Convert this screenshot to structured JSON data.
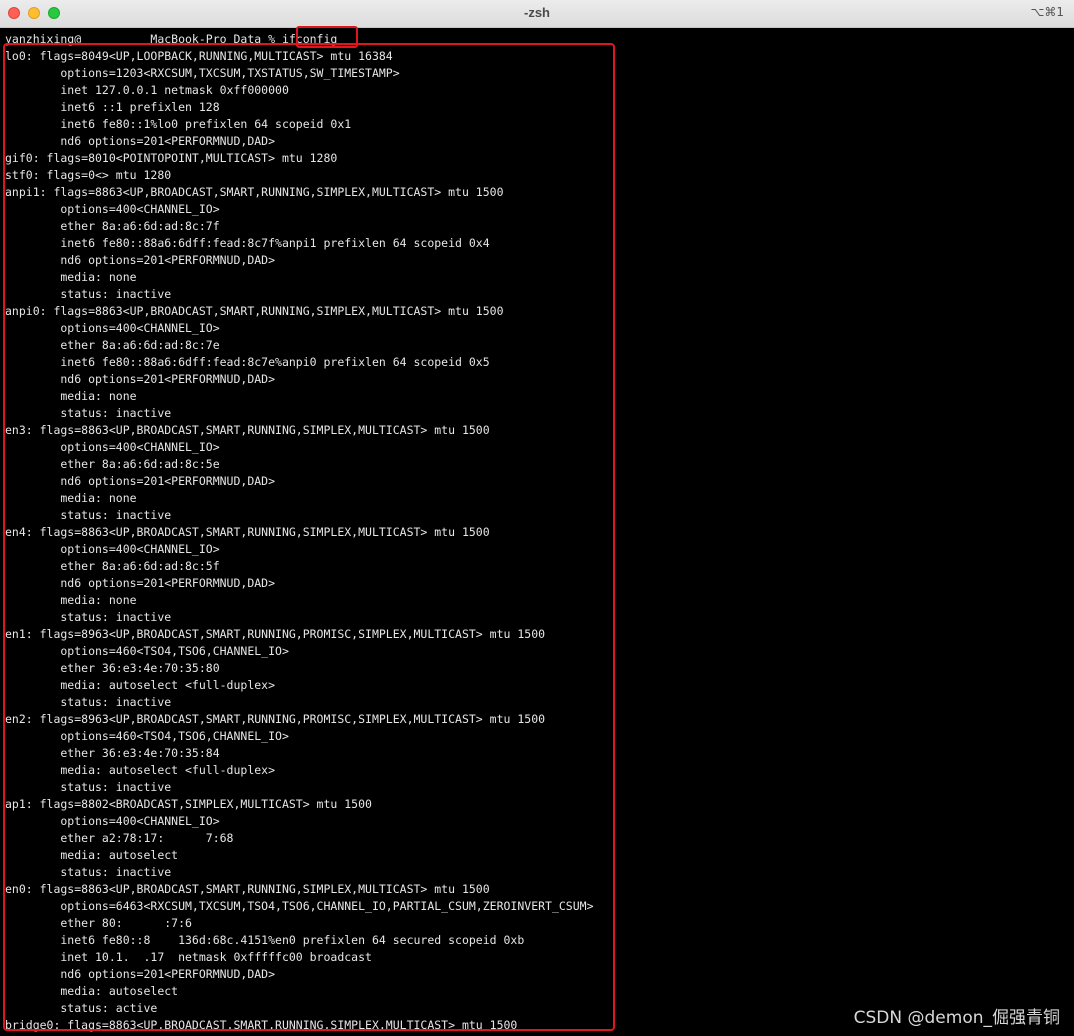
{
  "window": {
    "title": "-zsh",
    "shortcut": "⌥⌘1"
  },
  "terminal": {
    "lines": [
      "yanzhixing@          MacBook-Pro Data % ifconfig",
      "lo0: flags=8049<UP,LOOPBACK,RUNNING,MULTICAST> mtu 16384",
      "        options=1203<RXCSUM,TXCSUM,TXSTATUS,SW_TIMESTAMP>",
      "        inet 127.0.0.1 netmask 0xff000000",
      "        inet6 ::1 prefixlen 128",
      "        inet6 fe80::1%lo0 prefixlen 64 scopeid 0x1",
      "        nd6 options=201<PERFORMNUD,DAD>",
      "gif0: flags=8010<POINTOPOINT,MULTICAST> mtu 1280",
      "stf0: flags=0<> mtu 1280",
      "anpi1: flags=8863<UP,BROADCAST,SMART,RUNNING,SIMPLEX,MULTICAST> mtu 1500",
      "        options=400<CHANNEL_IO>",
      "        ether 8a:a6:6d:ad:8c:7f",
      "        inet6 fe80::88a6:6dff:fead:8c7f%anpi1 prefixlen 64 scopeid 0x4",
      "        nd6 options=201<PERFORMNUD,DAD>",
      "        media: none",
      "        status: inactive",
      "anpi0: flags=8863<UP,BROADCAST,SMART,RUNNING,SIMPLEX,MULTICAST> mtu 1500",
      "        options=400<CHANNEL_IO>",
      "        ether 8a:a6:6d:ad:8c:7e",
      "        inet6 fe80::88a6:6dff:fead:8c7e%anpi0 prefixlen 64 scopeid 0x5",
      "        nd6 options=201<PERFORMNUD,DAD>",
      "        media: none",
      "        status: inactive",
      "en3: flags=8863<UP,BROADCAST,SMART,RUNNING,SIMPLEX,MULTICAST> mtu 1500",
      "        options=400<CHANNEL_IO>",
      "        ether 8a:a6:6d:ad:8c:5e",
      "        nd6 options=201<PERFORMNUD,DAD>",
      "        media: none",
      "        status: inactive",
      "en4: flags=8863<UP,BROADCAST,SMART,RUNNING,SIMPLEX,MULTICAST> mtu 1500",
      "        options=400<CHANNEL_IO>",
      "        ether 8a:a6:6d:ad:8c:5f",
      "        nd6 options=201<PERFORMNUD,DAD>",
      "        media: none",
      "        status: inactive",
      "en1: flags=8963<UP,BROADCAST,SMART,RUNNING,PROMISC,SIMPLEX,MULTICAST> mtu 1500",
      "        options=460<TSO4,TSO6,CHANNEL_IO>",
      "        ether 36:e3:4e:70:35:80",
      "        media: autoselect <full-duplex>",
      "        status: inactive",
      "en2: flags=8963<UP,BROADCAST,SMART,RUNNING,PROMISC,SIMPLEX,MULTICAST> mtu 1500",
      "        options=460<TSO4,TSO6,CHANNEL_IO>",
      "        ether 36:e3:4e:70:35:84",
      "        media: autoselect <full-duplex>",
      "        status: inactive",
      "ap1: flags=8802<BROADCAST,SIMPLEX,MULTICAST> mtu 1500",
      "        options=400<CHANNEL_IO>",
      "        ether a2:78:17:      7:68",
      "        media: autoselect",
      "        status: inactive",
      "en0: flags=8863<UP,BROADCAST,SMART,RUNNING,SIMPLEX,MULTICAST> mtu 1500",
      "        options=6463<RXCSUM,TXCSUM,TSO4,TSO6,CHANNEL_IO,PARTIAL_CSUM,ZEROINVERT_CSUM>",
      "        ether 80:      :7:6",
      "        inet6 fe80::8    136d:68c.4151%en0 prefixlen 64 secured scopeid 0xb",
      "        inet 10.1.  .17  netmask 0xfffffc00 broadcast",
      "        nd6 options=201<PERFORMNUD,DAD>",
      "        media: autoselect",
      "        status: active",
      "bridge0: flags=8863<UP,BROADCAST,SMART,RUNNING,SIMPLEX,MULTICAST> mtu 1500"
    ]
  },
  "watermark": "CSDN @demon_倔强青铜",
  "colors": {
    "background": "#000000",
    "text": "#e6e6e6",
    "highlight": "#e0161f"
  }
}
